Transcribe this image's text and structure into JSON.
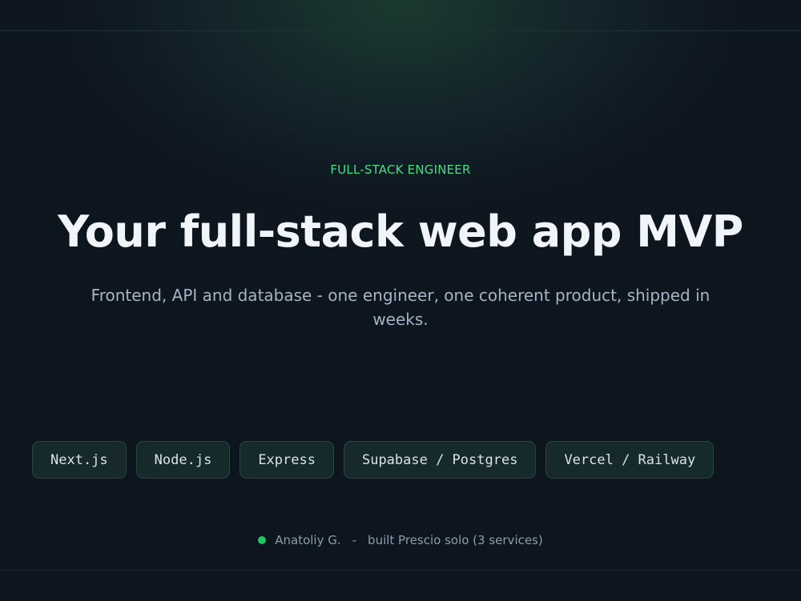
{
  "hero": {
    "eyebrow": "FULL-STACK ENGINEER",
    "headline": "Your full-stack web app MVP",
    "subtitle": "Frontend, API and database - one engineer, one coherent product, shipped in weeks."
  },
  "tech_stack": [
    {
      "label": "Next.js"
    },
    {
      "label": "Node.js"
    },
    {
      "label": "Express"
    },
    {
      "label": "Supabase / Postgres"
    },
    {
      "label": "Vercel / Railway"
    }
  ],
  "byline": {
    "status_color": "#22c55e",
    "name": "Anatoliy G.",
    "separator": "-",
    "note": "built Prescio solo (3 services)"
  },
  "colors": {
    "accent": "#4ade80",
    "background": "#0d151e",
    "headline": "#f1f5f9"
  }
}
